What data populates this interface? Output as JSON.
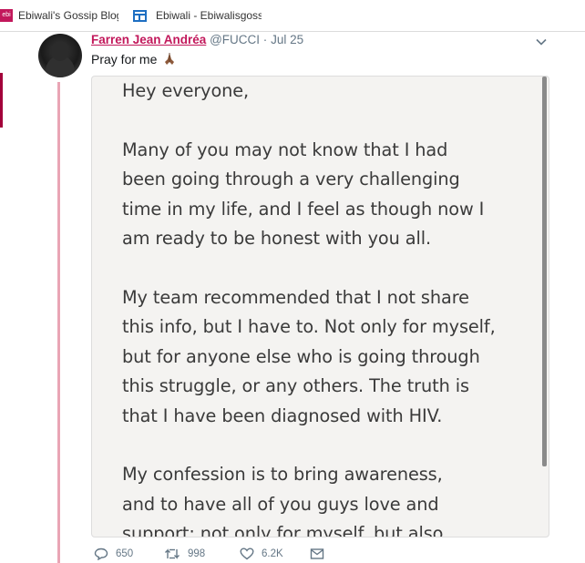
{
  "bookmarks": [
    {
      "label": "Ebiwali's Gossip Blog",
      "favicon_text": "ebi",
      "favicon_color": "#c2185b"
    },
    {
      "label": "Ebiwali - Ebiwalisgossip",
      "icon": "window-icon",
      "icon_color": "#1e6fc2"
    }
  ],
  "tweet": {
    "display_name": "Farren Jean Andréa",
    "handle": "@FUCCI",
    "separator": "·",
    "date": "Jul 25",
    "text": "Pray for me",
    "emoji": "folded-hands-icon",
    "name_color": "#c2185b",
    "thread_line_color": "#e9a5b5"
  },
  "image_note": {
    "lines": [
      "Hey everyone,",
      "Many of you may not know that I had\nbeen going through a very challenging\ntime in my life, and I feel as though now I\nam ready to be honest with you all.",
      "    My team recommended that I not share\nthis info, but I have to. Not only for myself,\nbut for anyone else who is going through\nthis struggle, or any others. The truth is\nthat I have been diagnosed with HIV.",
      "    My confession is to bring awareness,\nand to have all of you guys love and\nsupport: not only for myself. but also"
    ]
  },
  "actions": {
    "replies": "650",
    "retweets": "998",
    "likes": "6.2K"
  }
}
